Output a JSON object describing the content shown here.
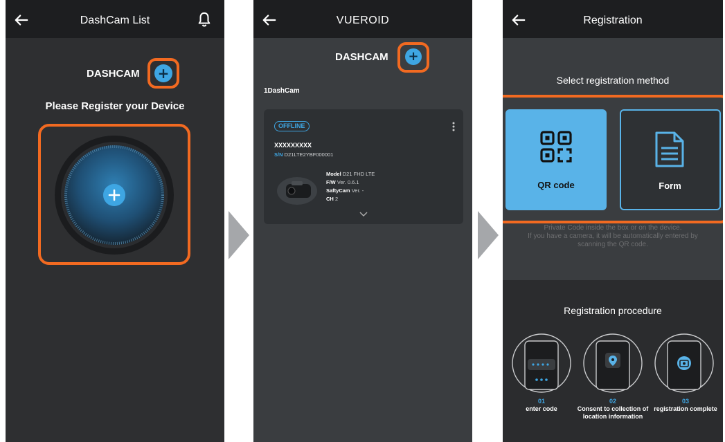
{
  "screen1": {
    "title": "DashCam List",
    "section_label": "DASHCAM",
    "prompt": "Please Register your Device",
    "icons": [
      "back-arrow-icon",
      "bell-icon",
      "plus-icon"
    ]
  },
  "screen2": {
    "title": "VUEROID",
    "section_label": "DASHCAM",
    "count_label": "1DashCam",
    "card": {
      "status": "OFFLINE",
      "name": "XXXXXXXXX",
      "sn_label": "S/N",
      "sn_value": "D21LTE2YBF000001",
      "model_label": "Model",
      "model_value": "D21 FHD LTE",
      "fw_label": "F/W",
      "fw_value": "Ver. 0.6.1",
      "safety_label": "SaftyCam",
      "safety_value": "Ver. -",
      "ch_label": "CH",
      "ch_value": "2"
    }
  },
  "screen3": {
    "title": "Registration",
    "select_heading": "Select registration method",
    "options": [
      {
        "label": "QR code",
        "icon": "qr-code-icon"
      },
      {
        "label": "Form",
        "icon": "document-icon"
      }
    ],
    "help_line1": "Private Code inside the box or on the device.",
    "help_line2": "If you have a camera, it will be automatically entered by",
    "help_line3": "scanning the QR code.",
    "procedure_heading": "Registration procedure",
    "steps": [
      {
        "num": "01",
        "label": "enter code"
      },
      {
        "num": "02",
        "label": "Consent to collection of location information"
      },
      {
        "num": "03",
        "label": "registration complete"
      }
    ]
  },
  "colors": {
    "accent_blue": "#3ea6e3",
    "highlight_orange": "#f26a21",
    "app_bar": "#1d1e20"
  }
}
